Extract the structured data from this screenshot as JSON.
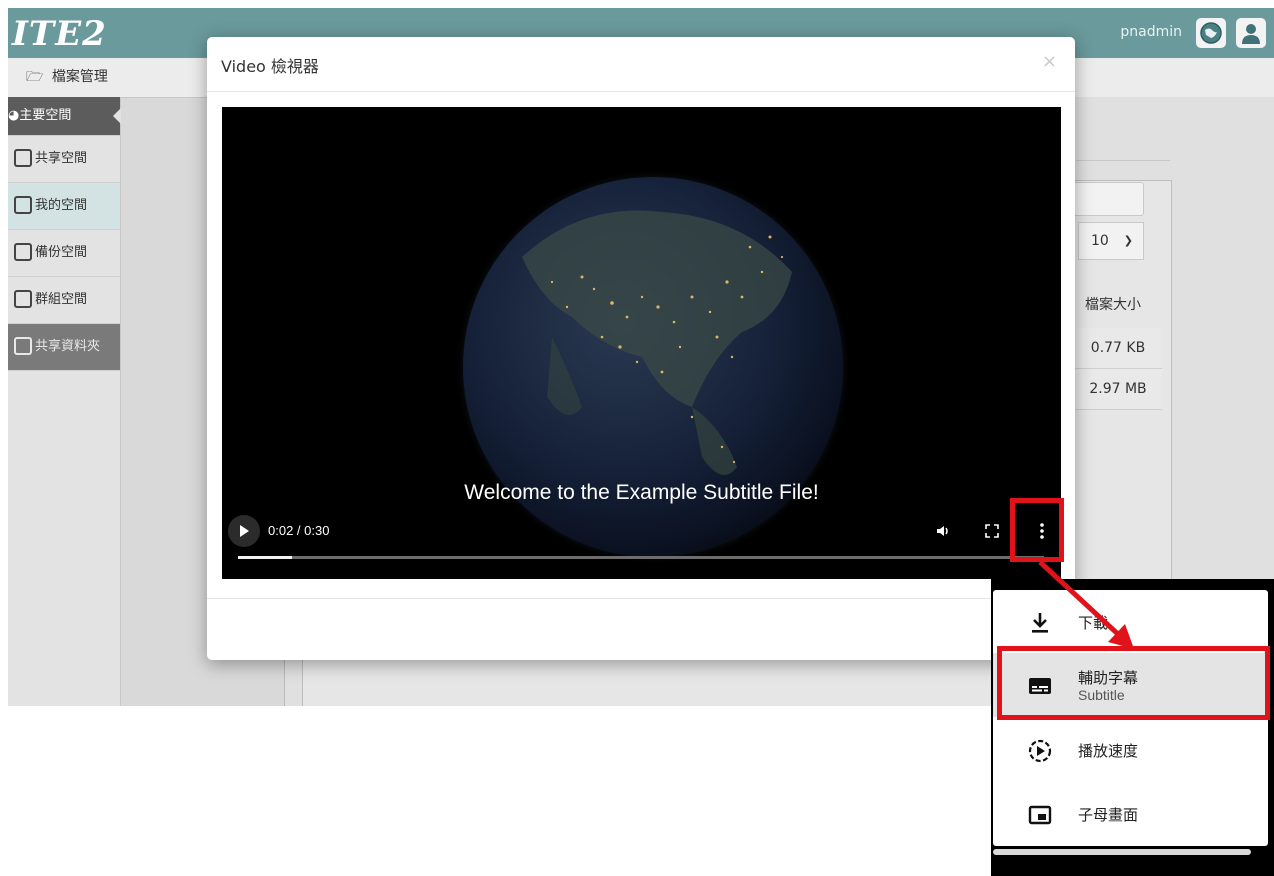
{
  "app": {
    "logo": "ITE2",
    "user": "pnadmin",
    "breadcrumb": "檔案管理",
    "colors": {
      "topbar": "#6a9a9c",
      "highlight": "#e0131b"
    }
  },
  "sidebar": {
    "header": "主要空間",
    "items": [
      {
        "label": "共享空間",
        "icon": "globe-icon"
      },
      {
        "label": "我的空間",
        "icon": "home-icon"
      },
      {
        "label": "備份空間",
        "icon": "backup-icon"
      },
      {
        "label": "群組空間",
        "icon": "group-icon"
      },
      {
        "label": "共享資料夾",
        "icon": "folder-icon"
      }
    ]
  },
  "background_table": {
    "page_size": "10",
    "column_header": "檔案大小",
    "rows": [
      "0.77 KB",
      "2.97 MB"
    ]
  },
  "modal": {
    "title": "Video 檢視器",
    "close": "×"
  },
  "video": {
    "subtitle": "Welcome to the Example Subtitle File!",
    "time": "0:02 / 0:30",
    "progress": 0.0667
  },
  "menu": {
    "items": [
      {
        "label": "下載",
        "icon": "download-icon"
      },
      {
        "label": "輔助字幕",
        "sublabel": "Subtitle",
        "icon": "subtitles-icon"
      },
      {
        "label": "播放速度",
        "icon": "playback-speed-icon"
      },
      {
        "label": "子母畫面",
        "icon": "picture-in-picture-icon"
      }
    ]
  }
}
